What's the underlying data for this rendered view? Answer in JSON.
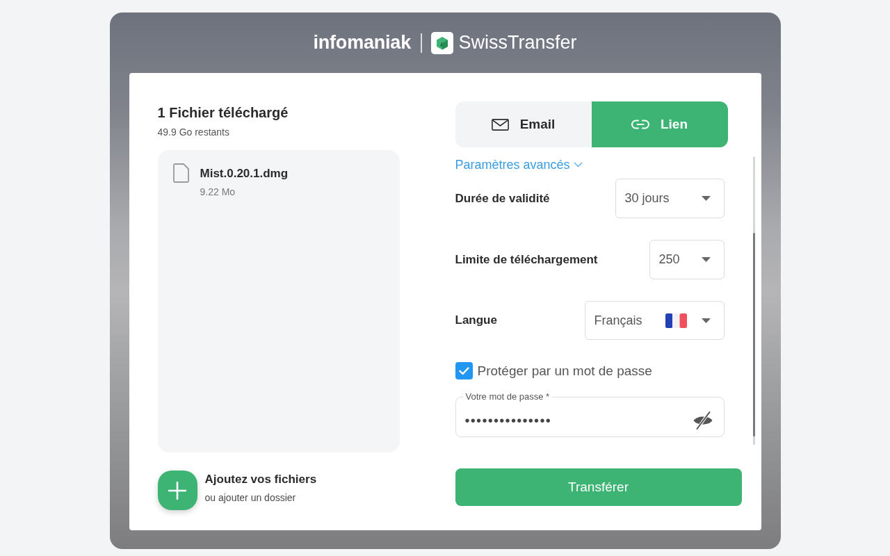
{
  "header": {
    "brand": "infomaniak",
    "product": "SwissTransfer"
  },
  "upload": {
    "title": "1 Fichier téléchargé",
    "remaining": "49.9 Go restants",
    "files": [
      {
        "name": "Mist.0.20.1.dmg",
        "size": "9.22 Mo"
      }
    ],
    "add_files": {
      "label": "Ajoutez vos fichiers",
      "sublabel": "ou ajouter un dossier"
    }
  },
  "transfer": {
    "tabs": [
      {
        "label": "Email",
        "selected": false
      },
      {
        "label": "Lien",
        "selected": true
      }
    ],
    "advanced_link": "Paramètres avancés",
    "settings": [
      {
        "kind": "select",
        "label": "Durée de validité",
        "value": "30 jours"
      },
      {
        "kind": "select",
        "label": "Limite de téléchargement",
        "value": "250"
      },
      {
        "kind": "language",
        "label": "Langue",
        "value": "Français"
      }
    ],
    "password_protect": {
      "label": "Protéger par un mot de passe",
      "checked": true
    },
    "password": {
      "label": "Votre mot de passe *",
      "value": "•••••••••••••••"
    },
    "submit": "Transférer"
  }
}
